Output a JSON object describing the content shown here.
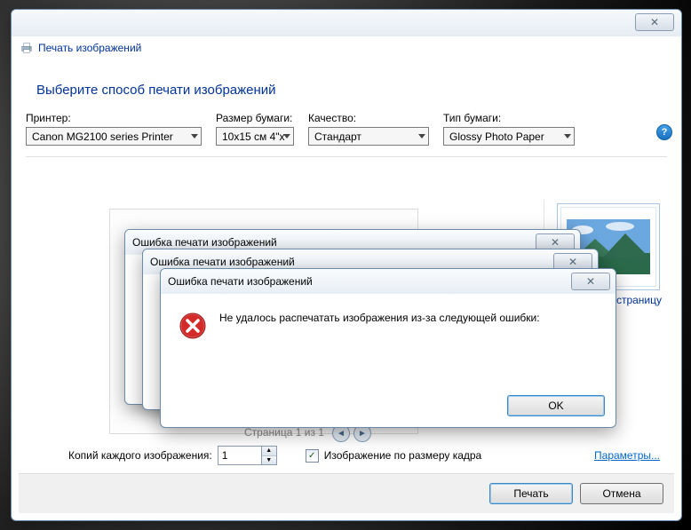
{
  "window": {
    "title": "Печать изображений"
  },
  "header": {
    "title": "Выберите способ печати изображений"
  },
  "labels": {
    "printer": "Принтер:",
    "paperSize": "Размер бумаги:",
    "quality": "Качество:",
    "paperType": "Тип бумаги:"
  },
  "selects": {
    "printer": "Canon MG2100 series Printer",
    "paperSize": "10x15 см 4\"x",
    "quality": "Стандарт",
    "paperType": "Glossy Photo Paper"
  },
  "preview": {
    "pageLabel": "Страница 1 из 1"
  },
  "rightPanel": {
    "caption": "ю страницу"
  },
  "copies": {
    "label": "Копий каждого изображения:",
    "value": "1"
  },
  "fitFrame": {
    "label": "Изображение по размеру кадра",
    "checked": true
  },
  "paramsLink": "Параметры...",
  "buttons": {
    "print": "Печать",
    "cancel": "Отмена"
  },
  "errorDialog": {
    "title": "Ошибка печати изображений",
    "message": "Не удалось распечатать изображения из-за следующей ошибки:",
    "ok": "OK"
  }
}
